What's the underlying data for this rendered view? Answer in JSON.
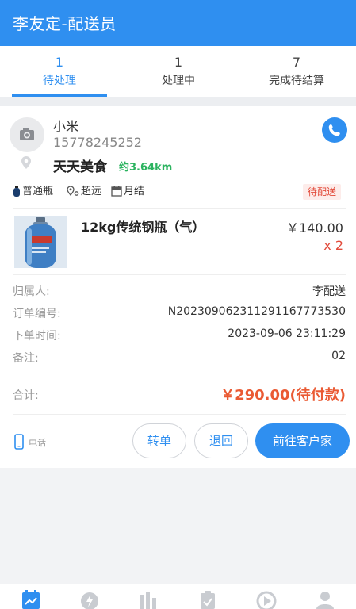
{
  "header": {
    "title": "李友定-配送员"
  },
  "tabs": [
    {
      "count": "1",
      "label": "待处理",
      "active": true
    },
    {
      "count": "1",
      "label": "处理中",
      "active": false
    },
    {
      "count": "7",
      "label": "完成待结算",
      "active": false
    }
  ],
  "order": {
    "customer_name": "小米",
    "customer_phone": "15778245252",
    "shop_name": "天天美食",
    "distance": "约3.64km",
    "tags": [
      "普通瓶",
      "超远",
      "月结"
    ],
    "status": "待配送",
    "product": {
      "name": "12kg传统钢瓶（气）",
      "price": "￥140.00",
      "quantity": "x 2"
    },
    "details": [
      {
        "label": "归属人:",
        "value": "李配送"
      },
      {
        "label": "订单编号:",
        "value": "N2023090623112911677735​30"
      },
      {
        "label": "下单时间:",
        "value": "2023-09-06 23:11:29"
      },
      {
        "label": "备注:",
        "value": "02"
      }
    ],
    "total_label": "合计:",
    "total_value": "￥290.00(待付款)",
    "phone_link_label": "电话",
    "actions": {
      "transfer": "转单",
      "return": "退回",
      "goto": "前往客户家"
    }
  },
  "colors": {
    "primary": "#2f8ff0",
    "accent_red": "#e24b3b",
    "total_orange": "#ea5a33",
    "green": "#2bb35f"
  },
  "tabbar_icons": [
    "calendar-chart-icon",
    "bolt-icon",
    "bar-chart-icon",
    "clipboard-check-icon",
    "play-icon",
    "user-icon"
  ]
}
